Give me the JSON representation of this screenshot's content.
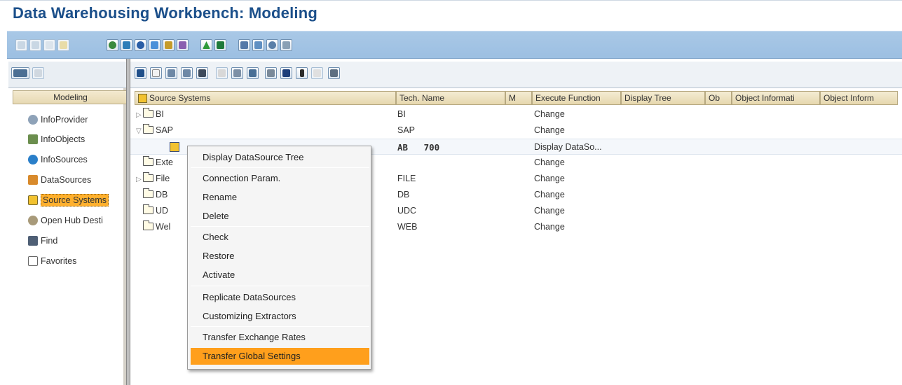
{
  "window": {
    "title": "Data Warehousing Workbench: Modeling"
  },
  "left_pane": {
    "header": "Modeling",
    "nav_items": [
      {
        "label": "InfoProvider",
        "icon": "infoprovider-icon"
      },
      {
        "label": "InfoObjects",
        "icon": "infoobjects-icon"
      },
      {
        "label": "InfoSources",
        "icon": "infosources-icon"
      },
      {
        "label": "DataSources",
        "icon": "datasources-icon"
      },
      {
        "label": "Source Systems",
        "icon": "source-systems-icon",
        "selected": true
      },
      {
        "label": "Open Hub Desti",
        "icon": "open-hub-icon"
      },
      {
        "label": "Find",
        "icon": "binoculars-icon"
      },
      {
        "label": "Favorites",
        "icon": "favorites-icon"
      }
    ]
  },
  "tree": {
    "columns": [
      "Source Systems",
      "Tech. Name",
      "M",
      "Execute Function",
      "Display Tree",
      "Ob",
      "Object Informati",
      "Object Inform"
    ],
    "rows": [
      {
        "name": "BI",
        "tech": "BI",
        "func": "Change"
      },
      {
        "name": "SAP",
        "tech": "SAP",
        "func": "Change"
      },
      {
        "name": "",
        "tech": "AB   700",
        "func": "Display DataSo..."
      },
      {
        "name": "Exte",
        "tech": "",
        "func": "Change"
      },
      {
        "name": "File",
        "tech": "FILE",
        "func": "Change"
      },
      {
        "name": "DB",
        "tech": "DB",
        "func": "Change"
      },
      {
        "name": "UD",
        "tech": "UDC",
        "func": "Change"
      },
      {
        "name": "Wel",
        "tech": "WEB",
        "func": "Change"
      }
    ]
  },
  "context_menu": {
    "items": [
      "Display DataSource Tree",
      "Connection Param.",
      "Rename",
      "Delete",
      "Check",
      "Restore",
      "Activate",
      "Replicate DataSources",
      "Customizing Extractors",
      "Transfer Exchange Rates",
      "Transfer Global Settings"
    ],
    "active_item": "Transfer Global Settings"
  },
  "colors": {
    "title": "#1b4f8a",
    "toolbar": "#9cbfe2",
    "selection": "#ffb02e",
    "menu_highlight": "#ff9f1c"
  }
}
